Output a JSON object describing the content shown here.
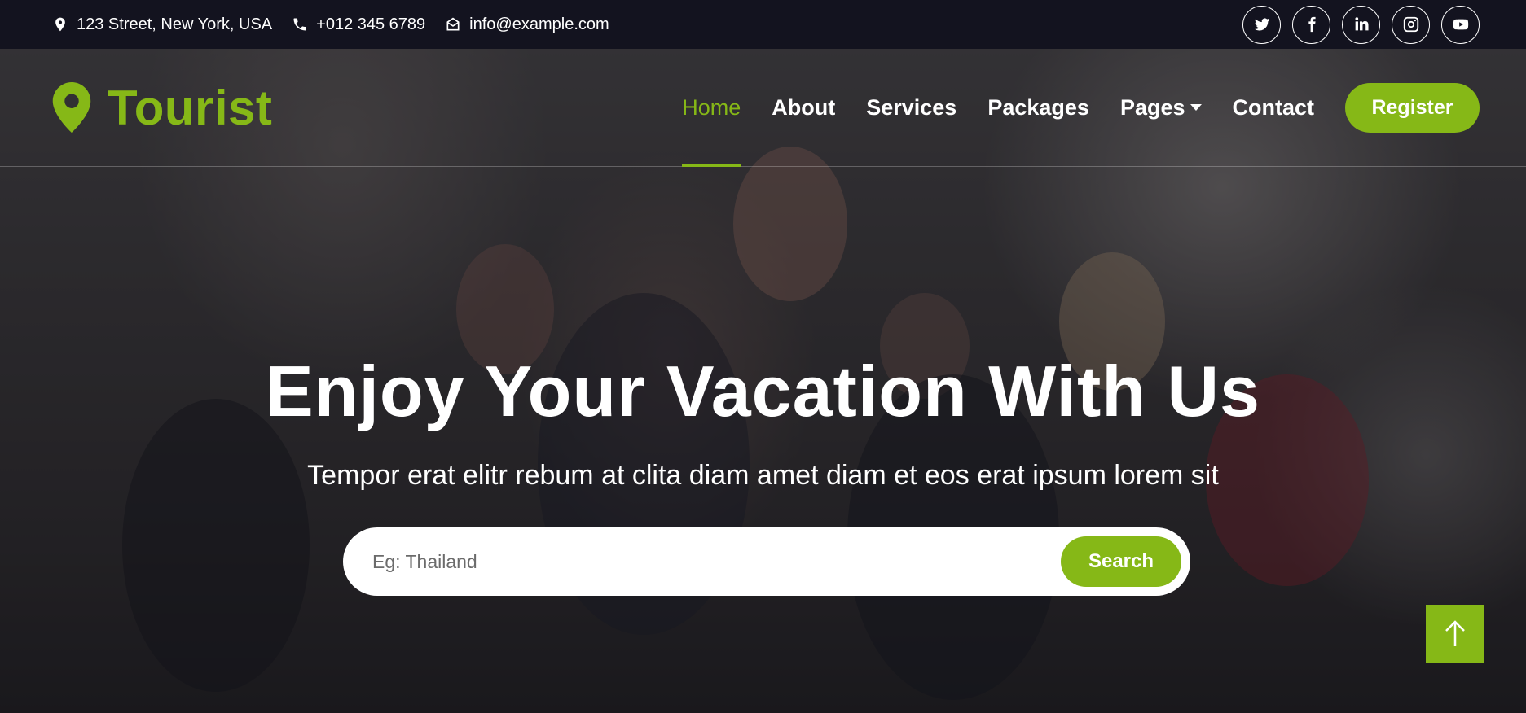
{
  "topbar": {
    "address": "123 Street, New York, USA",
    "phone": "+012 345 6789",
    "email": "info@example.com",
    "socials": [
      "twitter-icon",
      "facebook-icon",
      "linkedin-icon",
      "instagram-icon",
      "youtube-icon"
    ]
  },
  "brand": {
    "name": "Tourist"
  },
  "nav": {
    "items": [
      "Home",
      "About",
      "Services",
      "Packages",
      "Pages",
      "Contact"
    ],
    "active": "Home",
    "register": "Register"
  },
  "hero": {
    "title": "Enjoy Your Vacation With Us",
    "subtitle": "Tempor erat elitr rebum at clita diam amet diam et eos erat ipsum lorem sit",
    "search_placeholder": "Eg: Thailand",
    "search_button": "Search"
  },
  "colors": {
    "accent": "#86b817",
    "topbar_bg": "#13131f"
  }
}
